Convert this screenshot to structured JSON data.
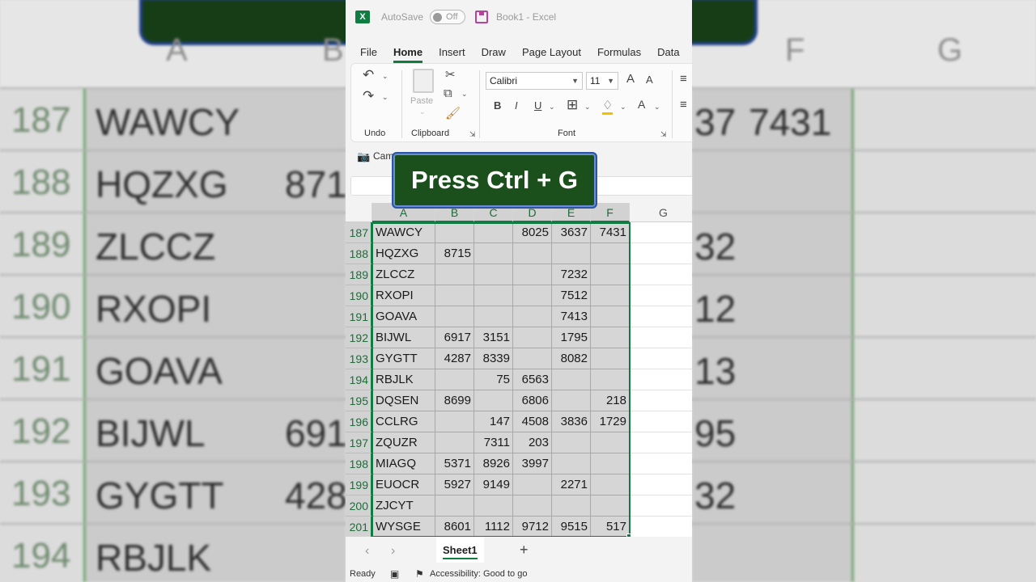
{
  "title_bar": {
    "autosave_label": "AutoSave",
    "autosave_state": "Off",
    "document_title": "Book1  -  Excel"
  },
  "tabs": [
    "File",
    "Home",
    "Insert",
    "Draw",
    "Page Layout",
    "Formulas",
    "Data"
  ],
  "active_tab": "Home",
  "ribbon": {
    "undo_label": "Undo",
    "clipboard_label": "Clipboard",
    "paste_label": "Paste",
    "font_group_label": "Font",
    "font_name": "Calibri",
    "font_size": "11",
    "bold": "B",
    "italic": "I",
    "underline": "U",
    "font_color_glyph": "A",
    "grow_glyph": "A",
    "shrink_glyph": "A",
    "camera_partial": "Cam"
  },
  "overlay_caption": "Press Ctrl + G",
  "columns": [
    "A",
    "B",
    "C",
    "D",
    "E",
    "F",
    "G"
  ],
  "rows": [
    {
      "num": "187",
      "a": "WAWCY",
      "b": "",
      "c": "",
      "d": "8025",
      "e": "3637",
      "f": "7431"
    },
    {
      "num": "188",
      "a": "HQZXG",
      "b": "8715",
      "c": "",
      "d": "",
      "e": "",
      "f": ""
    },
    {
      "num": "189",
      "a": "ZLCCZ",
      "b": "",
      "c": "",
      "d": "",
      "e": "7232",
      "f": ""
    },
    {
      "num": "190",
      "a": "RXOPI",
      "b": "",
      "c": "",
      "d": "",
      "e": "7512",
      "f": ""
    },
    {
      "num": "191",
      "a": "GOAVA",
      "b": "",
      "c": "",
      "d": "",
      "e": "7413",
      "f": ""
    },
    {
      "num": "192",
      "a": "BIJWL",
      "b": "6917",
      "c": "3151",
      "d": "",
      "e": "1795",
      "f": ""
    },
    {
      "num": "193",
      "a": "GYGTT",
      "b": "4287",
      "c": "8339",
      "d": "",
      "e": "8082",
      "f": ""
    },
    {
      "num": "194",
      "a": "RBJLK",
      "b": "",
      "c": "75",
      "d": "6563",
      "e": "",
      "f": ""
    },
    {
      "num": "195",
      "a": "DQSEN",
      "b": "8699",
      "c": "",
      "d": "6806",
      "e": "",
      "f": "218"
    },
    {
      "num": "196",
      "a": "CCLRG",
      "b": "",
      "c": "147",
      "d": "4508",
      "e": "3836",
      "f": "1729"
    },
    {
      "num": "197",
      "a": "ZQUZR",
      "b": "",
      "c": "7311",
      "d": "203",
      "e": "",
      "f": ""
    },
    {
      "num": "198",
      "a": "MIAGQ",
      "b": "5371",
      "c": "8926",
      "d": "3997",
      "e": "",
      "f": ""
    },
    {
      "num": "199",
      "a": "EUOCR",
      "b": "5927",
      "c": "9149",
      "d": "",
      "e": "2271",
      "f": ""
    },
    {
      "num": "200",
      "a": "ZJCYT",
      "b": "",
      "c": "",
      "d": "",
      "e": "",
      "f": ""
    },
    {
      "num": "201",
      "a": "WYSGE",
      "b": "8601",
      "c": "1112",
      "d": "9712",
      "e": "9515",
      "f": "517"
    }
  ],
  "sheet_tab": "Sheet1",
  "status": {
    "ready": "Ready",
    "accessibility": "Accessibility: Good to go"
  },
  "background_zoom": {
    "columns": [
      "A",
      "B",
      "F",
      "G"
    ],
    "rows": [
      {
        "num": "187",
        "name": "WAWCY",
        "right": "7431",
        "right_partial": "37"
      },
      {
        "num": "188",
        "name": "HQZXG",
        "left_partial": "871"
      },
      {
        "num": "189",
        "name": "ZLCCZ",
        "right_partial": "32"
      },
      {
        "num": "190",
        "name": "RXOPI",
        "right_partial": "12"
      },
      {
        "num": "191",
        "name": "GOAVA",
        "right_partial": "13"
      },
      {
        "num": "192",
        "name": "BIJWL",
        "left_partial": "691",
        "right_partial": "95"
      },
      {
        "num": "193",
        "name": "GYGTT",
        "left_partial": "428",
        "right_partial": "32"
      },
      {
        "num": "194",
        "name": "RBJLK"
      }
    ]
  },
  "colors": {
    "excel_green": "#107c41",
    "banner_green": "#1b4f1b",
    "banner_border": "#2c55a8",
    "selection_fill": "#d6d6d6"
  }
}
